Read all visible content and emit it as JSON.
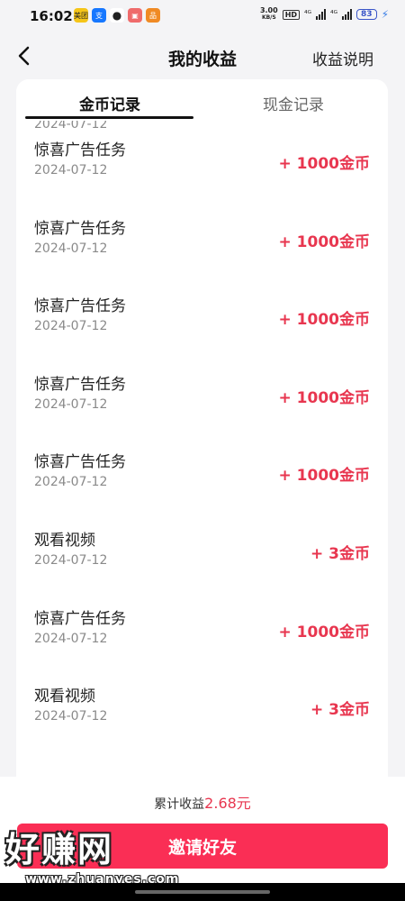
{
  "status_bar": {
    "time": "16:02",
    "apps": [
      {
        "icon": "meituan-icon",
        "label": "美团",
        "color": "#f5c518"
      },
      {
        "icon": "alipay-icon",
        "label": "支",
        "color": "#1677ff"
      },
      {
        "icon": "wechat-icon",
        "label": "●",
        "color": "#222222"
      },
      {
        "icon": "game-icon",
        "label": "▣",
        "color": "#ef6b6b"
      },
      {
        "icon": "app-icon",
        "label": "品",
        "color": "#f08a24"
      }
    ],
    "net_speed_value": "3.00",
    "net_speed_unit": "KB/S",
    "hd_label": "HD",
    "signal1_label": "⁴ᴳ",
    "signal2_label": "⁴ᴳ",
    "battery": "83"
  },
  "header": {
    "title": "我的收益",
    "explain_label": "收益说明"
  },
  "tabs": {
    "coin_label": "金币记录",
    "cash_label": "现金记录"
  },
  "partial_row": {
    "date": "2024-07-12"
  },
  "records": [
    {
      "title": "惊喜广告任务",
      "date": "2024-07-12",
      "amount": "+ 1000金币"
    },
    {
      "title": "惊喜广告任务",
      "date": "2024-07-12",
      "amount": "+ 1000金币"
    },
    {
      "title": "惊喜广告任务",
      "date": "2024-07-12",
      "amount": "+ 1000金币"
    },
    {
      "title": "惊喜广告任务",
      "date": "2024-07-12",
      "amount": "+ 1000金币"
    },
    {
      "title": "惊喜广告任务",
      "date": "2024-07-12",
      "amount": "+ 1000金币"
    },
    {
      "title": "观看视频",
      "date": "2024-07-12",
      "amount": "+ 3金币"
    },
    {
      "title": "惊喜广告任务",
      "date": "2024-07-12",
      "amount": "+ 1000金币"
    },
    {
      "title": "观看视频",
      "date": "2024-07-12",
      "amount": "+ 3金币"
    }
  ],
  "footer": {
    "total_label": "累计收益",
    "total_value": "2.68元",
    "invite_label": "邀请好友"
  },
  "watermark": {
    "text": "好赚网",
    "url": "www.zhuanyes.com"
  },
  "colors": {
    "accent": "#e8364f",
    "button": "#fa2e55"
  }
}
